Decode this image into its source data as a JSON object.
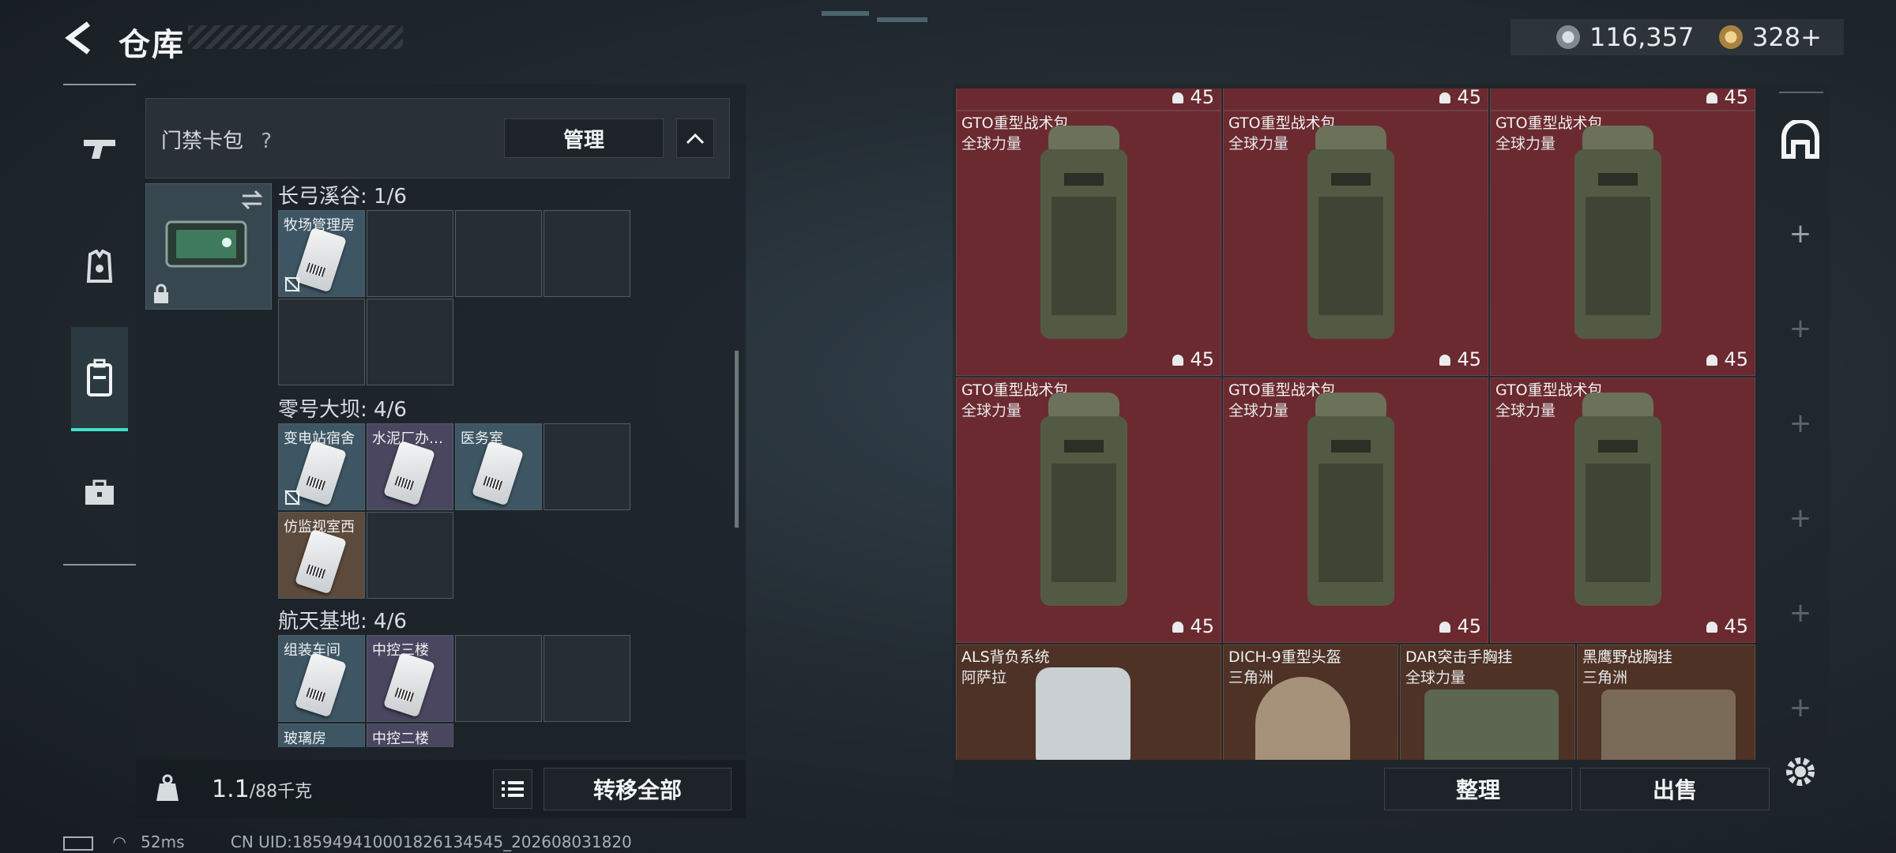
{
  "header": {
    "title": "仓库"
  },
  "currency": [
    {
      "icon": "silver-coin-icon",
      "value": "116,357",
      "color": "#b9c2c7"
    },
    {
      "icon": "gold-coin-icon",
      "value": "328+",
      "color": "#c9a15a"
    }
  ],
  "nav": {
    "items": [
      "weapon-icon",
      "armor-icon",
      "backpack-icon",
      "toolbox-icon"
    ],
    "active": "backpack-icon"
  },
  "left_panel": {
    "header_title": "门禁卡包",
    "help": "?",
    "manage_label": "管理",
    "groups": [
      {
        "title": "长弓溪谷: 1/6",
        "cards": [
          {
            "label": "牧场管理房",
            "color": "blue"
          }
        ]
      },
      {
        "title": "零号大坝: 4/6",
        "cards": [
          {
            "label": "变电站宿舍",
            "color": "blue"
          },
          {
            "label": "水泥厂办…",
            "color": "purple"
          },
          {
            "label": "医务室",
            "color": "blue"
          },
          {
            "label": "仿监视室西",
            "color": "brown"
          }
        ]
      },
      {
        "title": "航天基地: 4/6",
        "cards": [
          {
            "label": "组装车间",
            "color": "blue"
          },
          {
            "label": "中控三楼",
            "color": "purple"
          },
          {
            "label": "玻璃房",
            "color": "blue"
          },
          {
            "label": "中控二楼",
            "color": "purple"
          }
        ]
      }
    ]
  },
  "bottom": {
    "weight": "1.1",
    "weight_cap": "/88千克",
    "transfer_label": "转移全部"
  },
  "status": {
    "ping": "52ms",
    "uid": "CN UID:18594941000182613454​5_202608031820"
  },
  "grid": {
    "top_counts": [
      "45",
      "45",
      "45"
    ],
    "items": [
      {
        "name": "GTO重型战术包",
        "brand": "全球力量",
        "count": "45"
      },
      {
        "name": "GTO重型战术包",
        "brand": "全球力量",
        "count": "45"
      },
      {
        "name": "GTO重型战术包",
        "brand": "全球力量",
        "count": "45"
      },
      {
        "name": "GTO重型战术包",
        "brand": "全球力量",
        "count": "45"
      },
      {
        "name": "GTO重型战术包",
        "brand": "全球力量",
        "count": "45"
      },
      {
        "name": "GTO重型战术包",
        "brand": "全球力量",
        "count": "45"
      }
    ],
    "bottom_items": [
      {
        "name": "ALS背负系统",
        "brand": "阿萨拉"
      },
      {
        "name": "DICH-9重型头盔",
        "brand": "三角洲"
      },
      {
        "name": "DAR突击手胸挂",
        "brand": "全球力量"
      },
      {
        "name": "黑鹰野战胸挂",
        "brand": "三角洲"
      }
    ]
  },
  "actions": {
    "sort_label": "整理",
    "sell_label": "出售"
  }
}
